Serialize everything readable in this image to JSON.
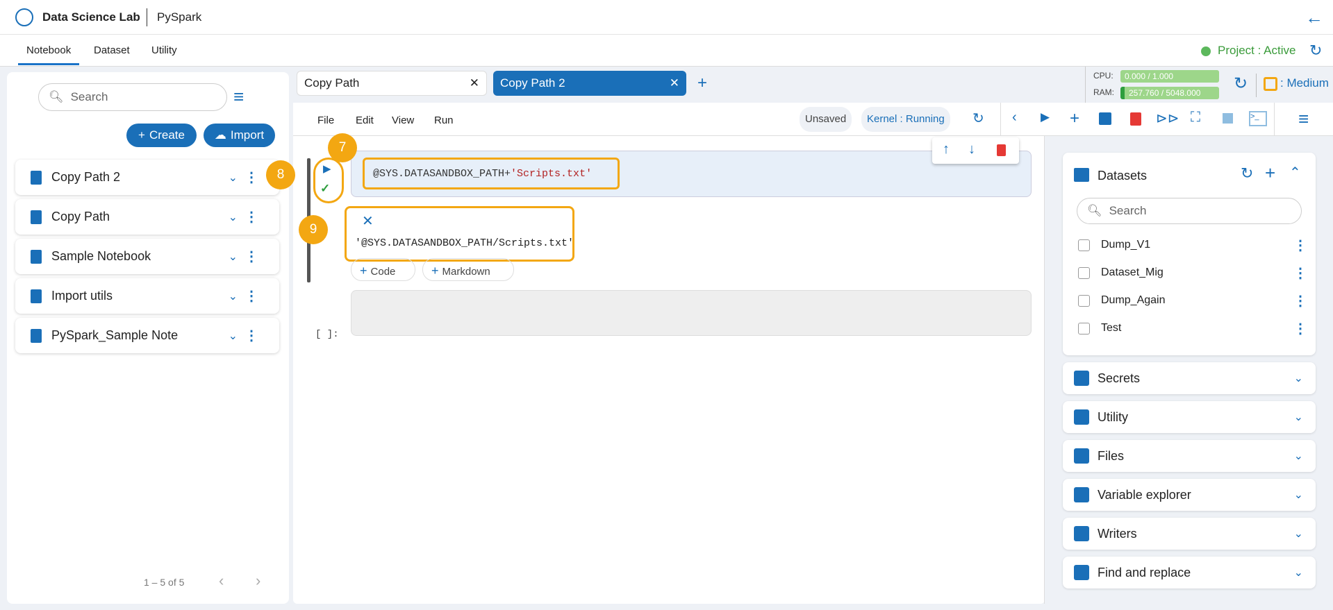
{
  "header": {
    "app_title": "Data Science Lab",
    "subtitle": "PySpark"
  },
  "nav": {
    "tabs": [
      "Notebook",
      "Dataset",
      "Utility"
    ],
    "project_status": "Project : Active"
  },
  "left": {
    "search_placeholder": "Search",
    "create_label": "Create",
    "import_label": "Import",
    "notebooks": [
      "Copy Path 2",
      "Copy Path",
      "Sample Notebook",
      "Import utils",
      "PySpark_Sample Note"
    ],
    "pagination": "1 – 5 of 5"
  },
  "editor": {
    "tabs": [
      "Copy Path",
      "Copy Path 2"
    ],
    "resources": {
      "cpu_label": "CPU:",
      "cpu_value": "0.000 / 1.000",
      "cpu_fraction": 0,
      "ram_label": "RAM:",
      "ram_value": "257.760 / 5048.000",
      "ram_fraction": 0.051,
      "size": ": Medium"
    },
    "menu": [
      "File",
      "Edit",
      "View",
      "Run"
    ],
    "saved_status": "Unsaved",
    "kernel_status": "Kernel : Running",
    "cell_code_var": "@SYS.DATASANDBOX_PATH+",
    "cell_code_str": "'Scripts.txt'",
    "output": "'@SYS.DATASANDBOX_PATH/Scripts.txt'",
    "add_code": "Code",
    "add_markdown": "Markdown",
    "empty_cell_prompt": "[ ]:",
    "badges": [
      "7",
      "8",
      "9"
    ]
  },
  "right": {
    "datasets_title": "Datasets",
    "search_placeholder": "Search",
    "datasets": [
      "Dump_V1",
      "Dataset_Mig",
      "Dump_Again",
      "Test"
    ],
    "sections": [
      "Secrets",
      "Utility",
      "Files",
      "Variable explorer",
      "Writers",
      "Find and replace"
    ]
  },
  "colors": {
    "accent": "#1a6fb8",
    "highlight": "#f3a712",
    "delete": "#e53935"
  }
}
